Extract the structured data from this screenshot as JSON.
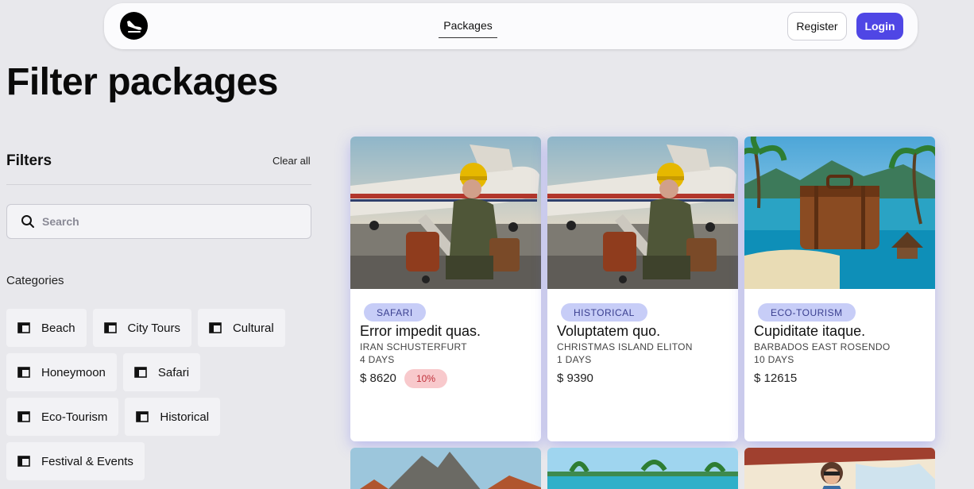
{
  "nav": {
    "logo_icon": "plane-landing-icon",
    "link": "Packages",
    "register": "Register",
    "login": "Login",
    "accent": "#4f46e5"
  },
  "page": {
    "title": "Filter packages"
  },
  "filters": {
    "title": "Filters",
    "clear": "Clear all",
    "search_placeholder": "Search",
    "categories_title": "Categories",
    "categories": [
      "Beach",
      "City Tours",
      "Cultural",
      "Honeymoon",
      "Safari",
      "Eco-Tourism",
      "Historical",
      "Festival & Events"
    ]
  },
  "packages": [
    {
      "tag": "SAFARI",
      "title": "Error impedit quas.",
      "location": "IRAN SCHUSTERFURT",
      "duration": "4 DAYS",
      "price": "$ 8620",
      "discount": "10%"
    },
    {
      "tag": "HISTORICAL",
      "title": "Voluptatem quo.",
      "location": "CHRISTMAS ISLAND ELITON",
      "duration": "1 DAYS",
      "price": "$ 9390"
    },
    {
      "tag": "ECO-TOURISM",
      "title": "Cupiditate itaque.",
      "location": "BARBADOS EAST ROSENDO",
      "duration": "10 DAYS",
      "price": "$ 12615"
    }
  ]
}
